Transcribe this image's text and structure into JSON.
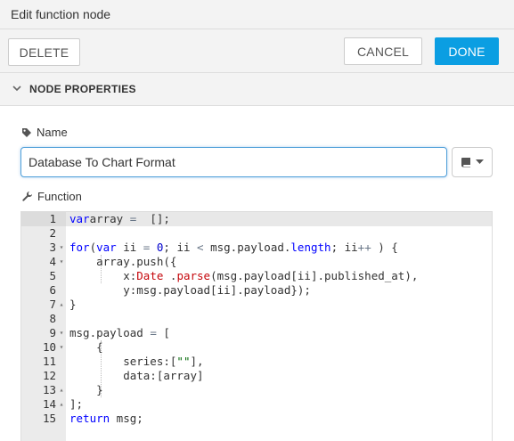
{
  "titlebar": {
    "title": "Edit function node"
  },
  "toolbar": {
    "delete_label": "DELETE",
    "cancel_label": "CANCEL",
    "done_label": "DONE"
  },
  "section": {
    "label": "NODE PROPERTIES"
  },
  "name_field": {
    "label": "Name",
    "value": "Database To Chart Format"
  },
  "function_field": {
    "label": "Function"
  },
  "colors": {
    "accent": "#0b9ee2",
    "header_bg": "#f3f3f3",
    "gutter_bg": "#ebebeb",
    "keyword": "#0000ff",
    "builtin": "#c5060b"
  },
  "icons": [
    "chevron-down-icon",
    "tag-icon",
    "book-icon",
    "caret-down-icon",
    "wrench-icon"
  ],
  "editor": {
    "lines": [
      {
        "n": "1",
        "fold": "",
        "tokens": [
          [
            "kw",
            "var"
          ],
          [
            "",
            "array "
          ],
          [
            "op",
            "="
          ],
          [
            "",
            "  [];"
          ]
        ]
      },
      {
        "n": "2",
        "fold": "",
        "tokens": []
      },
      {
        "n": "3",
        "fold": "▾",
        "tokens": [
          [
            "kw",
            "for"
          ],
          [
            "",
            "("
          ],
          [
            "kw",
            "var"
          ],
          [
            "",
            " ii "
          ],
          [
            "op",
            "="
          ],
          [
            "",
            " "
          ],
          [
            "num",
            "0"
          ],
          [
            "",
            "; ii "
          ],
          [
            "op",
            "<"
          ],
          [
            "",
            " msg.payload."
          ],
          [
            "kw",
            "length"
          ],
          [
            "",
            "; ii"
          ],
          [
            "op",
            "++"
          ],
          [
            "",
            " ) {"
          ]
        ]
      },
      {
        "n": "4",
        "fold": "▾",
        "tokens": [
          [
            "",
            "    array.push({"
          ]
        ]
      },
      {
        "n": "5",
        "fold": "",
        "tokens": [
          [
            "",
            "        x:"
          ],
          [
            "fn",
            "Date"
          ],
          [
            "",
            " ."
          ],
          [
            "fn",
            "parse"
          ],
          [
            "",
            "(msg.payload[ii].published_at),"
          ]
        ]
      },
      {
        "n": "6",
        "fold": "",
        "tokens": [
          [
            "",
            "        y:msg.payload[ii].payload});"
          ]
        ]
      },
      {
        "n": "7",
        "fold": "▴",
        "tokens": [
          [
            "",
            "}"
          ]
        ]
      },
      {
        "n": "8",
        "fold": "",
        "tokens": []
      },
      {
        "n": "9",
        "fold": "▾",
        "tokens": [
          [
            "",
            "msg.payload "
          ],
          [
            "op",
            "="
          ],
          [
            "",
            " ["
          ]
        ]
      },
      {
        "n": "10",
        "fold": "▾",
        "tokens": [
          [
            "",
            "    {"
          ]
        ]
      },
      {
        "n": "11",
        "fold": "",
        "tokens": [
          [
            "",
            "        series:["
          ],
          [
            "str",
            "\"\""
          ],
          [
            "",
            "],"
          ]
        ]
      },
      {
        "n": "12",
        "fold": "",
        "tokens": [
          [
            "",
            "        data:[array]"
          ]
        ]
      },
      {
        "n": "13",
        "fold": "▴",
        "tokens": [
          [
            "",
            "    }"
          ]
        ]
      },
      {
        "n": "14",
        "fold": "▴",
        "tokens": [
          [
            "",
            "];"
          ]
        ]
      },
      {
        "n": "15",
        "fold": "",
        "tokens": [
          [
            "kw",
            "return"
          ],
          [
            "",
            " msg;"
          ]
        ]
      }
    ]
  }
}
